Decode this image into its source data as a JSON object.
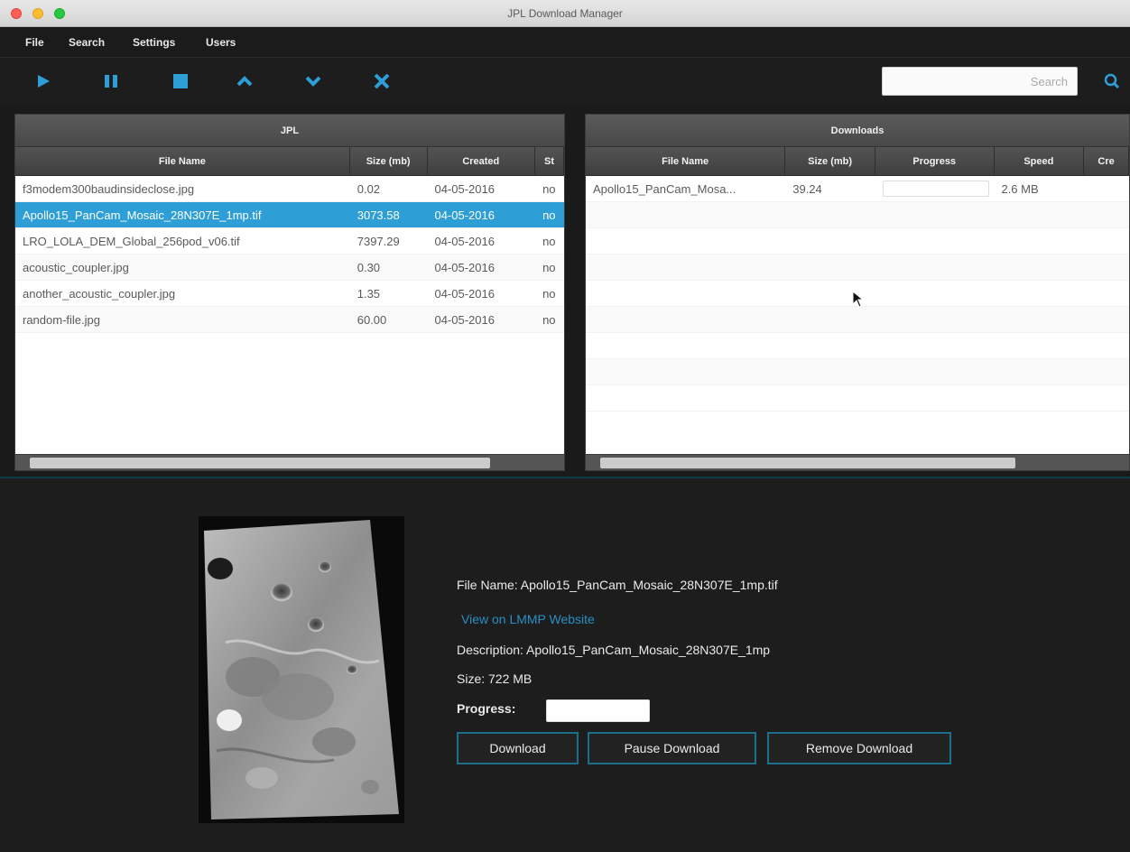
{
  "window": {
    "title": "JPL Download Manager"
  },
  "menu": [
    "File",
    "Search",
    "Settings",
    "Users"
  ],
  "toolbar": {
    "icons": [
      "play-icon",
      "pause-icon",
      "stop-icon",
      "chevron-up-icon",
      "chevron-down-icon",
      "close-icon"
    ],
    "search_placeholder": "Search",
    "search_icon": "search-icon",
    "accent": "#2e9fd6"
  },
  "jpl_panel": {
    "title": "JPL",
    "columns": [
      "File Name",
      "Size (mb)",
      "Created",
      "St"
    ],
    "rows": [
      [
        "f3modem300baudinsideclose.jpg",
        "0.02",
        "04-05-2016",
        "no"
      ],
      [
        "Apollo15_PanCam_Mosaic_28N307E_1mp.tif",
        "3073.58",
        "04-05-2016",
        "no"
      ],
      [
        "LRO_LOLA_DEM_Global_256pod_v06.tif",
        "7397.29",
        "04-05-2016",
        "no"
      ],
      [
        "acoustic_coupler.jpg",
        "0.30",
        "04-05-2016",
        "no"
      ],
      [
        "another_acoustic_coupler.jpg",
        "1.35",
        "04-05-2016",
        "no"
      ],
      [
        "random-file.jpg",
        "60.00",
        "04-05-2016",
        "no"
      ]
    ],
    "selected_index": 1
  },
  "downloads_panel": {
    "title": "Downloads",
    "columns": [
      "File Name",
      "Size (mb)",
      "Progress",
      "Speed",
      "Cre"
    ],
    "rows": [
      {
        "file": "Apollo15_PanCam_Mosa...",
        "size": "39.24",
        "progress": 0,
        "speed": "2.6 MB",
        "created": ""
      }
    ]
  },
  "detail": {
    "file_name": "File Name: Apollo15_PanCam_Mosaic_28N307E_1mp.tif",
    "link_text": "View on LMMP Website",
    "description": "Description: Apollo15_PanCam_Mosaic_28N307E_1mp",
    "size": "Size: 722 MB",
    "progress_label": "Progress:",
    "progress_value": 0,
    "buttons": {
      "download": "Download",
      "pause": "Pause Download",
      "remove": "Remove Download"
    }
  }
}
